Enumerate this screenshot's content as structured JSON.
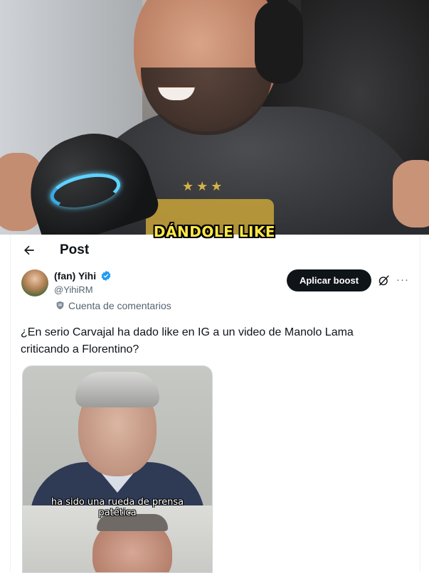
{
  "video": {
    "caption": "DÁNDOLE LIKE",
    "accent_colors": {
      "caption": "#ffe84a",
      "mic_ring": "#5fd2ff"
    }
  },
  "header": {
    "back_icon": "arrow-left-icon",
    "title": "Post"
  },
  "tweet": {
    "author_name": "(fan) Yihi",
    "verified_icon": "verified-badge-icon",
    "handle": "@YihiRM",
    "account_label_icon": "shield-label-icon",
    "account_label": "Cuenta de comentarios",
    "boost_button": "Aplicar boost",
    "grok_icon": "grok-icon",
    "more_icon": "more-horizontal-icon",
    "text": "¿En serio Carvajal ha dado like en IG a un video de Manolo Lama criticando a Florentino?",
    "media": {
      "subtitle_line1": "ha sido una rueda de prensa",
      "subtitle_line2": "patética"
    }
  },
  "colors": {
    "text_primary": "#0f1419",
    "text_secondary": "#536471",
    "verified_blue": "#1d9bf0",
    "button_bg": "#0f1419",
    "button_text": "#ffffff"
  }
}
